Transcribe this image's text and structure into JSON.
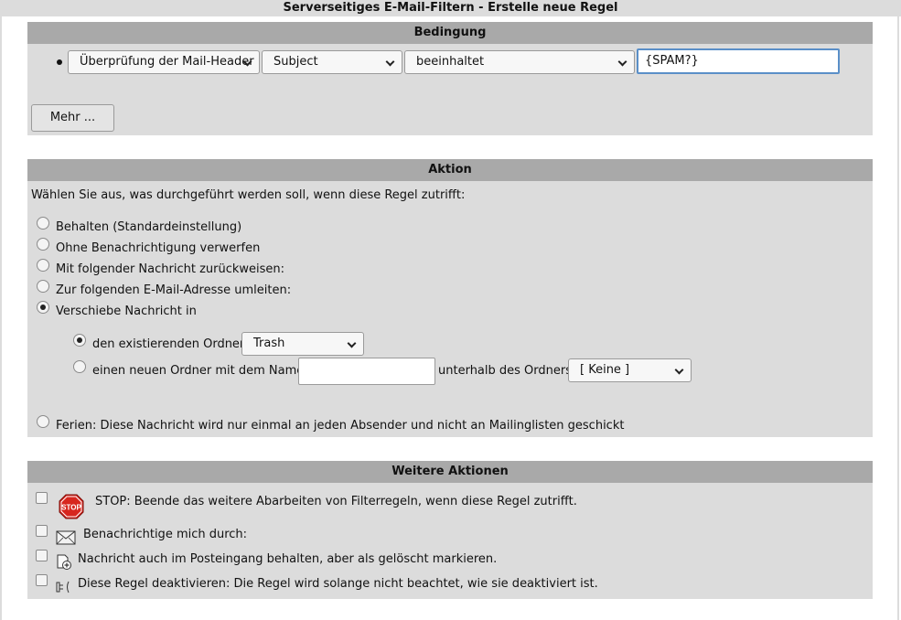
{
  "window": {
    "title": "Serverseitiges E-Mail-Filtern - Erstelle neue Regel"
  },
  "condition": {
    "header": "Bedingung",
    "header_select": "Überprüfung der Mail-Header",
    "field_select": "Subject",
    "operator_select": "beeinhaltet",
    "value": "{SPAM?}",
    "more_button": "Mehr ..."
  },
  "action": {
    "header": "Aktion",
    "intro": "Wählen Sie aus, was durchgeführt werden soll, wenn diese Regel zutrifft:",
    "options": [
      {
        "label": "Behalten (Standardeinstellung)",
        "checked": false
      },
      {
        "label": "Ohne Benachrichtigung verwerfen",
        "checked": false
      },
      {
        "label": "Mit folgender Nachricht zurückweisen:",
        "checked": false
      },
      {
        "label": "Zur folgenden E-Mail-Adresse umleiten:",
        "checked": false
      },
      {
        "label": "Verschiebe Nachricht in",
        "checked": true
      }
    ],
    "move": {
      "existing_label": "den existierenden Ordner",
      "existing_checked": true,
      "existing_folder": "Trash",
      "new_label": "einen neuen Ordner mit dem Namen",
      "new_checked": false,
      "new_name_value": "",
      "below_label": "unterhalb des Ordners",
      "parent_folder": "[ Keine ]"
    },
    "vacation": {
      "label": "Ferien: Diese Nachricht wird nur einmal an jeden Absender und nicht an Mailinglisten geschickt",
      "checked": false
    }
  },
  "further": {
    "header": "Weitere Aktionen",
    "items": [
      {
        "icon": "stop-sign-icon",
        "label": "STOP: Beende das weitere Abarbeiten von Filterregeln, wenn diese Regel zutrifft.",
        "checked": false
      },
      {
        "icon": "envelope-icon",
        "label": "Benachrichtige mich durch:",
        "checked": false
      },
      {
        "icon": "document-delete-icon",
        "label": "Nachricht auch im Posteingang behalten, aber als gelöscht markieren.",
        "checked": false
      },
      {
        "icon": "disable-rule-icon",
        "label": "Diese Regel deaktivieren: Die Regel wird solange nicht beachtet, wie sie deaktiviert ist.",
        "checked": false
      }
    ],
    "stop_icon_text": "STOP"
  },
  "colors": {
    "panel_bg": "#dcdcdc",
    "panel_header_bg": "#a9a9a9",
    "focus_border": "#5a8fc8",
    "stop_red": "#d7261e"
  }
}
